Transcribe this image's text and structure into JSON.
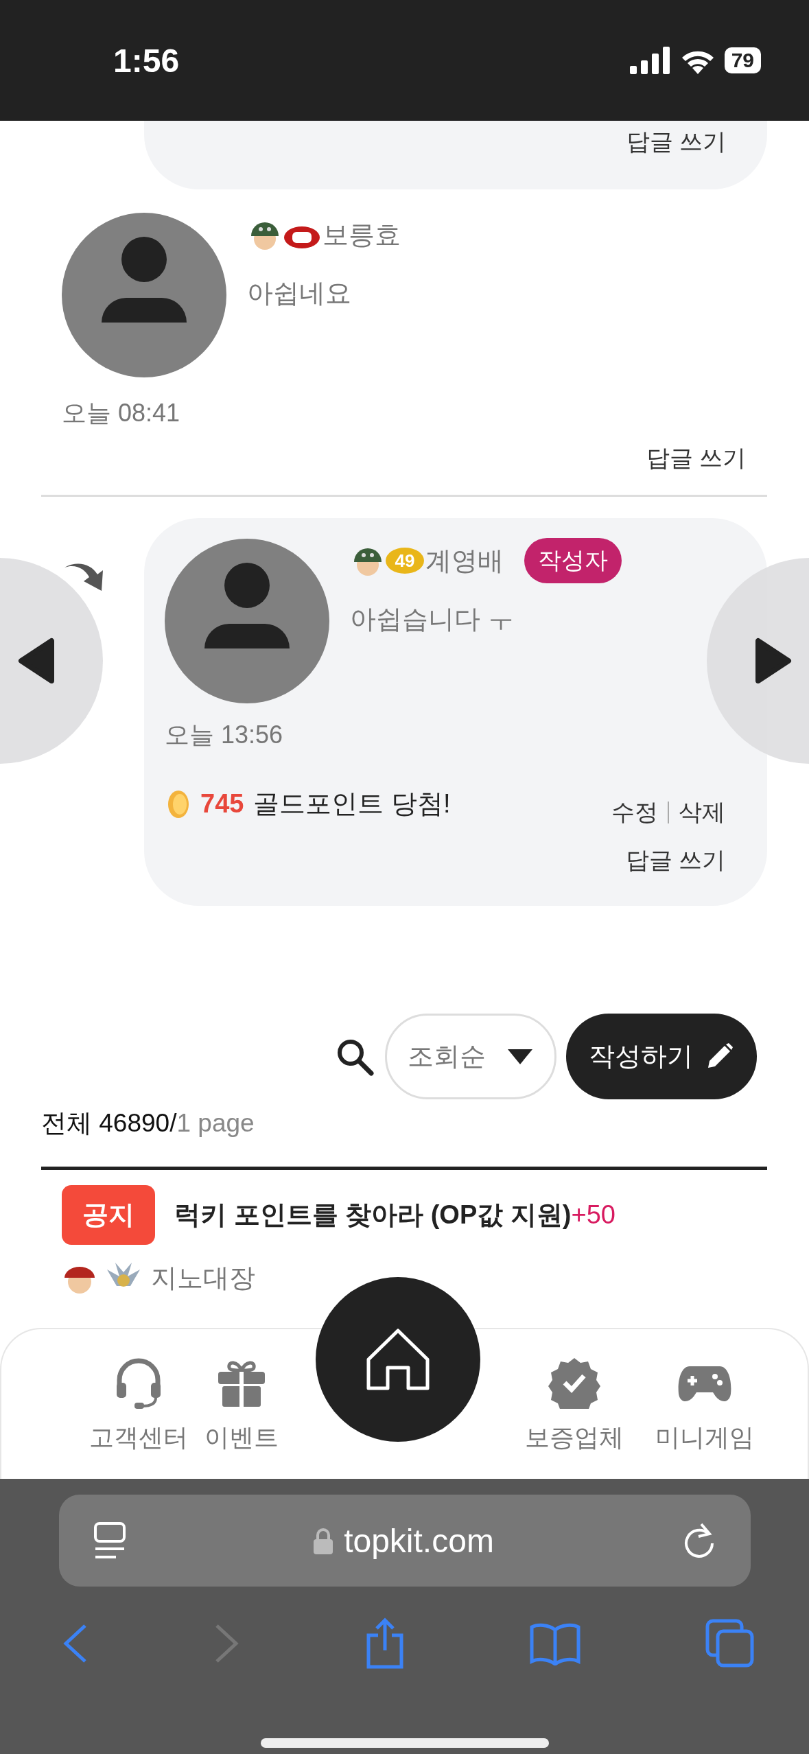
{
  "status_bar": {
    "time": "1:56",
    "battery": "79"
  },
  "previous_card": {
    "reply_label": "답글 쓰기"
  },
  "comments": [
    {
      "kind": "comment",
      "badges": [
        {
          "kind": "helmet"
        },
        {
          "kind": "level_hidden"
        }
      ],
      "author": "보릉효",
      "text": "아쉽네요",
      "time": "오늘 08:41",
      "reply_label": "답글 쓰기"
    },
    {
      "kind": "reply",
      "badges": [
        {
          "kind": "helmet"
        },
        {
          "kind": "level",
          "label": "49"
        }
      ],
      "author": "계영배",
      "author_tag": "작성자",
      "text": "아쉽습니다 ㅜ",
      "time": "오늘 13:56",
      "gold": {
        "amount": "745",
        "text": "골드포인트 당첨!"
      },
      "actions": [
        "수정",
        "삭제"
      ],
      "reply_label": "답글 쓰기"
    }
  ],
  "toolbar": {
    "sort": "조회순",
    "write_button": "작성하기"
  },
  "summary": {
    "total": "전체 46890/",
    "page": "1 page"
  },
  "notices": [
    {
      "tag": "공지",
      "title": "럭키 포인트를 찾아라 (OP값 지원)",
      "points": "+50",
      "badges": [
        {
          "kind": "admin"
        },
        {
          "kind": "rank"
        }
      ],
      "author": "지노대장"
    }
  ],
  "bottom_nav": {
    "items": [
      {
        "label": "고객센터"
      },
      {
        "label": "이벤트"
      },
      {
        "label": "보증업체"
      },
      {
        "label": "미니게임"
      }
    ]
  },
  "browser": {
    "url": "topkit.com",
    "back_disabled": false,
    "forward_disabled": true
  }
}
